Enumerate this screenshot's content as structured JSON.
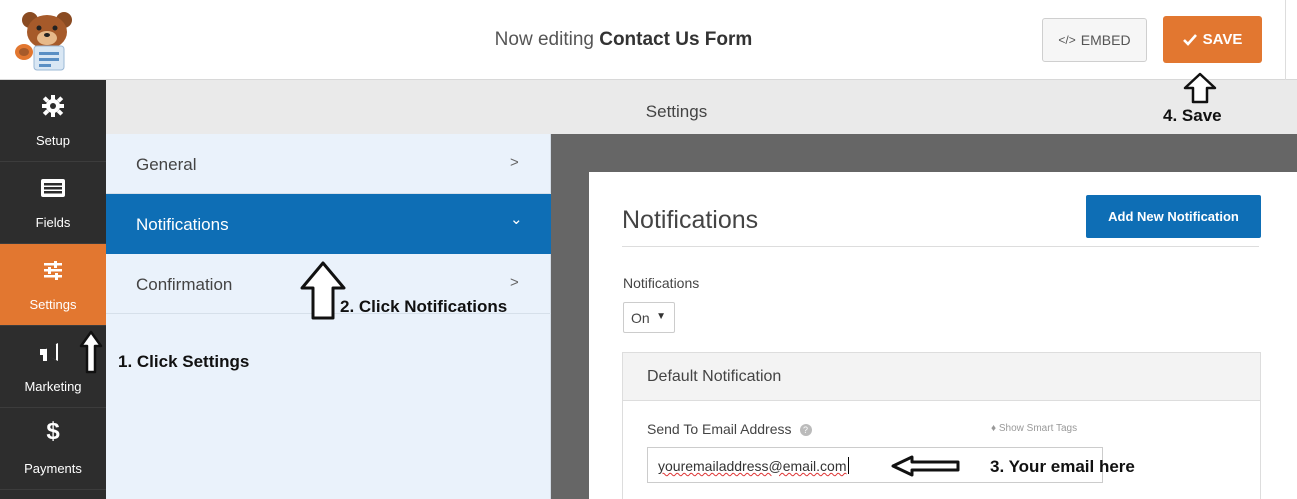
{
  "header": {
    "prefix": "Now editing",
    "form_name": "Contact Us Form",
    "embed_label": "EMBED",
    "save_label": "SAVE"
  },
  "sidebar": {
    "items": [
      {
        "label": "Setup",
        "icon": "gear-icon"
      },
      {
        "label": "Fields",
        "icon": "fields-icon"
      },
      {
        "label": "Settings",
        "icon": "sliders-icon"
      },
      {
        "label": "Marketing",
        "icon": "megaphone-icon"
      },
      {
        "label": "Payments",
        "icon": "dollar-icon"
      }
    ],
    "active": "Settings"
  },
  "settings": {
    "title": "Settings",
    "menu": [
      {
        "label": "General",
        "chevron": ">"
      },
      {
        "label": "Notifications",
        "chevron": "⌄"
      },
      {
        "label": "Confirmation",
        "chevron": ">"
      }
    ],
    "active": "Notifications"
  },
  "panel": {
    "title": "Notifications",
    "add_button": "Add New Notification",
    "notifications_label": "Notifications",
    "notifications_value": "On",
    "default_notification_title": "Default Notification",
    "send_to_label": "Send To Email Address",
    "smart_tags_label": "Show Smart Tags",
    "email_value": "youremailaddress@email.com"
  },
  "annotations": {
    "step1": "1. Click Settings",
    "step2": "2. Click Notifications",
    "step3": "3. Your email here",
    "step4": "4. Save"
  },
  "colors": {
    "accent_orange": "#e27730",
    "accent_blue": "#0e6eb5",
    "sidebar_bg": "#2d2d2d",
    "submenu_bg": "#eaf2fb"
  }
}
